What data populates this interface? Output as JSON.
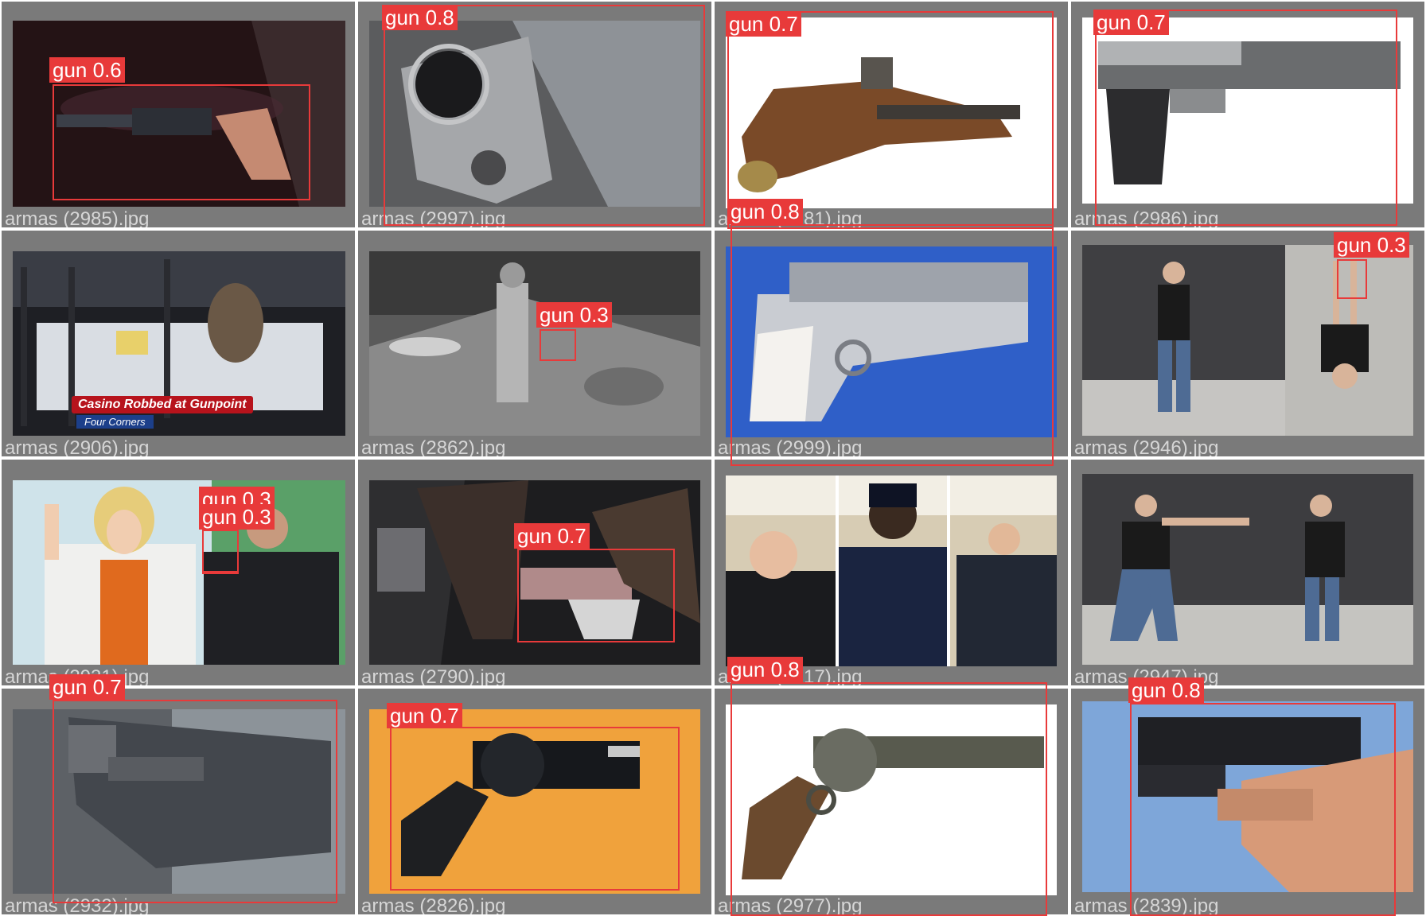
{
  "grid": {
    "tiles": [
      {
        "filename": "armas (2985).jpg"
      },
      {
        "filename": "armas (2997).jpg"
      },
      {
        "filename": "armas (2981).jpg"
      },
      {
        "filename": "armas (2986).jpg"
      },
      {
        "filename": "armas (2906).jpg",
        "caption": "Casino Robbed at Gunpoint",
        "subcaption": "Four Corners"
      },
      {
        "filename": "armas (2862).jpg"
      },
      {
        "filename": "armas (2999).jpg"
      },
      {
        "filename": "armas (2946).jpg"
      },
      {
        "filename": "armas (2931).jpg"
      },
      {
        "filename": "armas (2790).jpg"
      },
      {
        "filename": "armas (2817).jpg"
      },
      {
        "filename": "armas (2947).jpg"
      },
      {
        "filename": "armas (2932).jpg"
      },
      {
        "filename": "armas (2826).jpg"
      },
      {
        "filename": "armas (2977).jpg"
      },
      {
        "filename": "armas (2839).jpg"
      }
    ]
  },
  "detections": [
    {
      "tile": 0,
      "label": "gun 0.6"
    },
    {
      "tile": 1,
      "label": "gun 0.8"
    },
    {
      "tile": 2,
      "label": "gun 0.7"
    },
    {
      "tile": 3,
      "label": "gun 0.7"
    },
    {
      "tile": 6,
      "label": "gun 0.8"
    },
    {
      "tile": 5,
      "label": "gun 0.3"
    },
    {
      "tile": 7,
      "label": "gun 0.3"
    },
    {
      "tile": 8,
      "label": "gun 0.3"
    },
    {
      "tile": 8,
      "label": "gun 0.3"
    },
    {
      "tile": 9,
      "label": "gun 0.7"
    },
    {
      "tile": 12,
      "label": "gun 0.7"
    },
    {
      "tile": 13,
      "label": "gun 0.7"
    },
    {
      "tile": 14,
      "label": "gun 0.8"
    },
    {
      "tile": 15,
      "label": "gun 0.8"
    }
  ],
  "colors": {
    "box": "#e83a3a",
    "label_text": "#ffffff",
    "tile_background": "#7a7a7a",
    "filename_text": "#d6d6d6"
  }
}
